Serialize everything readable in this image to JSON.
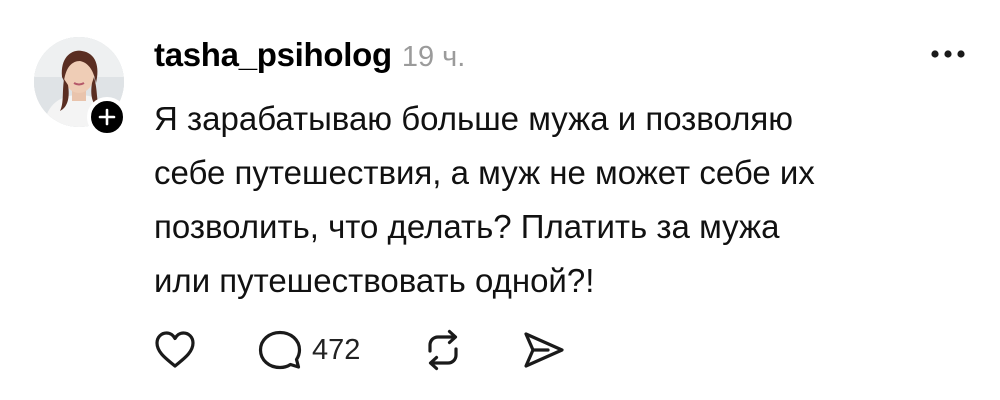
{
  "post": {
    "username": "tasha_psiholog",
    "timestamp": "19 ч.",
    "text": "Я зарабатываю больше мужа и позволяю\nсебе путешествия, а муж не может себе их\nпозволить, что делать? Платить за мужа\nили путешествовать одной?!",
    "reply_count": "472"
  },
  "icons": {
    "more": "more-horizontal-icon",
    "follow": "plus-icon",
    "like": "heart-icon",
    "reply": "speech-bubble-icon",
    "repost": "repost-arrows-icon",
    "share": "send-icon"
  },
  "colors": {
    "text": "#000000",
    "muted": "#9b9b9b",
    "icon": "#1a1a1a",
    "background": "#ffffff"
  }
}
